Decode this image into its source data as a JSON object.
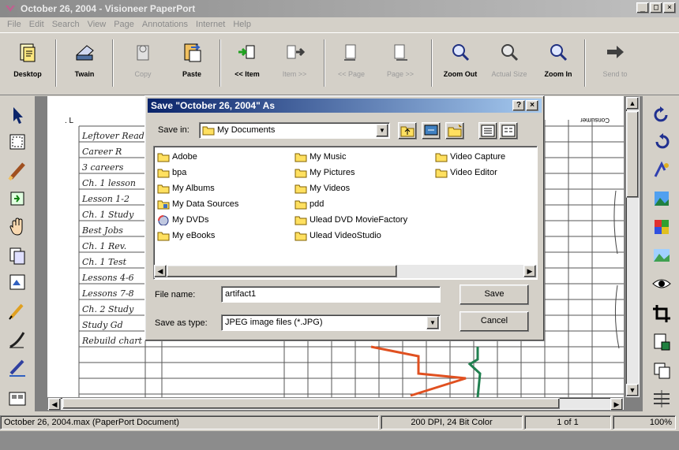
{
  "window": {
    "title": "October 26, 2004 - Visioneer PaperPort",
    "controls": [
      "_",
      "□",
      "×"
    ]
  },
  "menu": [
    "File",
    "Edit",
    "Search",
    "View",
    "Page",
    "Annotations",
    "Internet",
    "Help"
  ],
  "toolbar": {
    "desktop": "Desktop",
    "twain": "Twain",
    "copy": "Copy",
    "paste": "Paste",
    "prev_item": "<< Item",
    "next_item": "Item >>",
    "prev_page": "<< Page",
    "next_page": "Page >>",
    "zoom_out": "Zoom Out",
    "actual_size": "Actual Size",
    "zoom_in": "Zoom In",
    "send": "Send to"
  },
  "dialog": {
    "title": "Save \"October 26, 2004\" As",
    "help_btn": "?",
    "close_btn": "×",
    "save_in_label": "Save in:",
    "save_in_value": "My Documents",
    "items": [
      "Adobe",
      "bpa",
      "My Albums",
      "My Data Sources",
      "My DVDs",
      "My eBooks",
      "My Music",
      "My Pictures",
      "My Videos",
      "pdd",
      "Ulead DVD MovieFactory",
      "Ulead VideoStudio",
      "Video Capture",
      "Video Editor"
    ],
    "file_name_label": "File name:",
    "file_name_value": "artifact1",
    "save_type_label": "Save as type:",
    "save_type_value": "JPEG image files (*.JPG)",
    "save_button": "Save",
    "cancel_button": "Cancel"
  },
  "document": {
    "handwritten_rows": [
      "Leftover Reading",
      "Career R",
      "3 careers",
      "Ch. 1 lesson",
      "Lesson 1-2",
      "Ch. 1 Study",
      "Best Jobs",
      "Ch. 1 Rev.",
      "Ch. 1 Test",
      "Lessons 4-6",
      "Lessons 7-8",
      "Ch. 2 Study",
      "Study Gd",
      "Rebuild chart"
    ],
    "header_fragment": "Consumer"
  },
  "statusbar": {
    "document": "October 26, 2004.max (PaperPort Document)",
    "resolution": "200 DPI, 24 Bit Color",
    "page": "1 of 1",
    "zoom": "100%"
  }
}
